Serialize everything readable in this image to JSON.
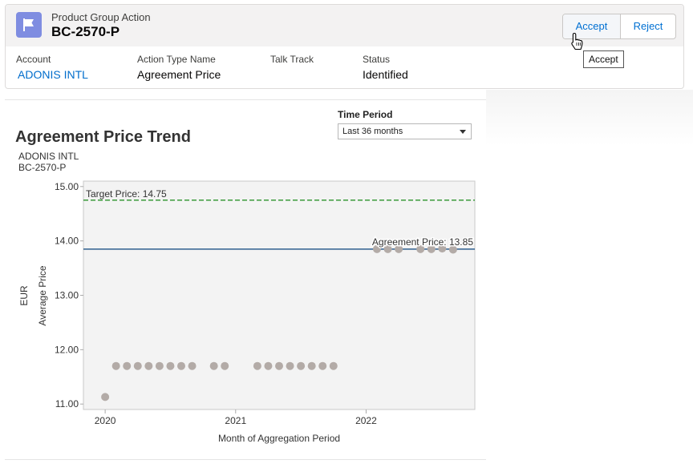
{
  "record": {
    "object_type": "Product Group Action",
    "title": "BC-2570-P",
    "icon": "flag-icon",
    "accent_color": "#7f8de1"
  },
  "actions": {
    "accept_label": "Accept",
    "reject_label": "Reject"
  },
  "fields": [
    {
      "label": "Account",
      "value": "ADONIS INTL",
      "is_link": true
    },
    {
      "label": "Action Type Name",
      "value": "Agreement Price",
      "is_link": false
    },
    {
      "label": "Talk Track",
      "value": "",
      "is_link": false
    },
    {
      "label": "Status",
      "value": "Identified",
      "is_link": false
    }
  ],
  "tooltip": "Accept",
  "time_period": {
    "label": "Time Period",
    "selected": "Last 36 months"
  },
  "chart_header": {
    "title": "Agreement Price Trend",
    "subtitle_1": "ADONIS INTL",
    "subtitle_2": "BC-2570-P"
  },
  "chart_data": {
    "type": "scatter",
    "xlabel": "Month of Aggregation Period",
    "ylabel_outer": "EUR",
    "ylabel_inner": "Average Price",
    "x_range": [
      "2019-11",
      "2022-11"
    ],
    "xticks": [
      "2020",
      "2021",
      "2022"
    ],
    "ylim": [
      10.9,
      15.1
    ],
    "yticks": [
      "11.00",
      "12.00",
      "13.00",
      "14.00",
      "15.00"
    ],
    "grid": false,
    "reference_lines": [
      {
        "label": "Target Price: 14.75",
        "value": 14.75,
        "style": "dashed",
        "color": "#3a9a3a"
      },
      {
        "label": "Agreement Price: 13.85",
        "value": 13.85,
        "style": "solid",
        "color": "#2f5f8f"
      }
    ],
    "point_color": "#b3aba7",
    "points": [
      {
        "x": "2020-01",
        "y": 11.13
      },
      {
        "x": "2020-02",
        "y": 11.7
      },
      {
        "x": "2020-03",
        "y": 11.7
      },
      {
        "x": "2020-04",
        "y": 11.7
      },
      {
        "x": "2020-05",
        "y": 11.7
      },
      {
        "x": "2020-06",
        "y": 11.7
      },
      {
        "x": "2020-07",
        "y": 11.7
      },
      {
        "x": "2020-08",
        "y": 11.7
      },
      {
        "x": "2020-09",
        "y": 11.7
      },
      {
        "x": "2020-11",
        "y": 11.7
      },
      {
        "x": "2020-12",
        "y": 11.7
      },
      {
        "x": "2021-03",
        "y": 11.7
      },
      {
        "x": "2021-04",
        "y": 11.7
      },
      {
        "x": "2021-05",
        "y": 11.7
      },
      {
        "x": "2021-06",
        "y": 11.7
      },
      {
        "x": "2021-07",
        "y": 11.7
      },
      {
        "x": "2021-08",
        "y": 11.7
      },
      {
        "x": "2021-09",
        "y": 11.7
      },
      {
        "x": "2021-10",
        "y": 11.7
      },
      {
        "x": "2022-02",
        "y": 13.85
      },
      {
        "x": "2022-03",
        "y": 13.85
      },
      {
        "x": "2022-04",
        "y": 13.85
      },
      {
        "x": "2022-06",
        "y": 13.85
      },
      {
        "x": "2022-07",
        "y": 13.85
      },
      {
        "x": "2022-08",
        "y": 13.86
      },
      {
        "x": "2022-09",
        "y": 13.84
      }
    ]
  }
}
